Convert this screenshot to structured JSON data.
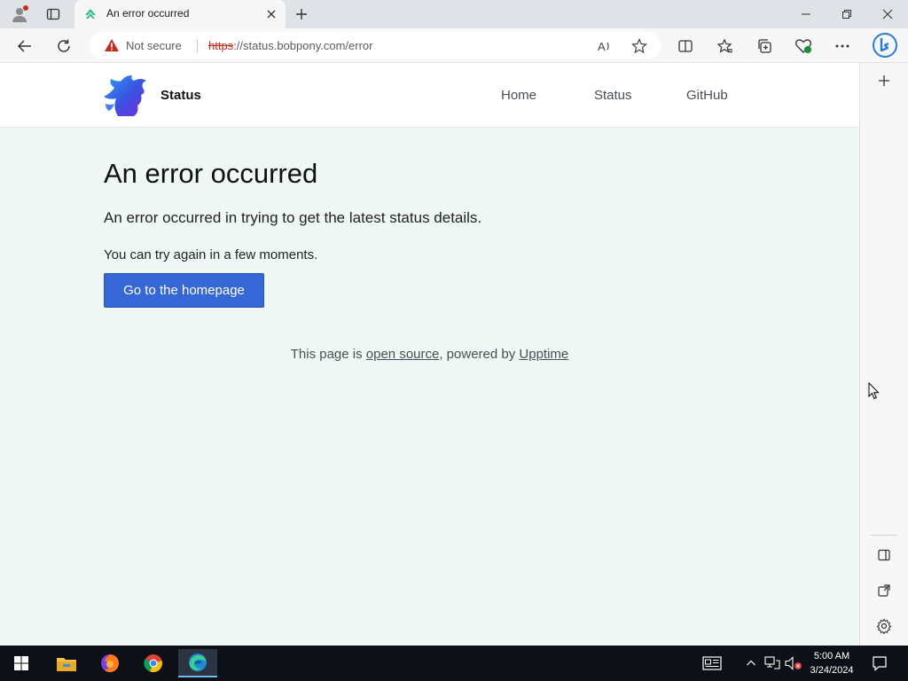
{
  "browser": {
    "tab": {
      "title": "An error occurred"
    },
    "address": {
      "security_label": "Not secure",
      "url_scheme": "https",
      "url_rest": "://status.bobpony.com/error"
    }
  },
  "site": {
    "brand": "Status",
    "nav": [
      {
        "label": "Home"
      },
      {
        "label": "Status"
      },
      {
        "label": "GitHub"
      }
    ],
    "heading": "An error occurred",
    "lead": "An error occurred in trying to get the latest status details.",
    "retry_text": "You can try again in a few moments.",
    "cta_label": "Go to the homepage",
    "footer": {
      "prefix": "This page is ",
      "link1": "open source",
      "middle": ", powered by ",
      "link2": "Upptime"
    }
  },
  "taskbar": {
    "time": "5:00 AM",
    "date": "3/24/2024"
  },
  "colors": {
    "accent_button": "#3567d6",
    "page_background": "#f0f8f6",
    "warning_red": "#c42b1c",
    "taskbar": "#0d1117"
  },
  "icons": [
    "profile-icon",
    "tab-actions-icon",
    "upptime-favicon-icon",
    "close-tab-icon",
    "new-tab-icon",
    "minimize-icon",
    "restore-icon",
    "close-window-icon",
    "back-icon",
    "refresh-icon",
    "warning-icon",
    "read-aloud-icon",
    "favorite-star-icon",
    "split-screen-icon",
    "favorites-icon",
    "collections-icon",
    "browser-essentials-icon",
    "more-icon",
    "bing-copilot-icon",
    "add-sidebar-icon",
    "sidebar-toggle-icon",
    "external-open-icon",
    "settings-icon",
    "windows-start-icon",
    "file-explorer-icon",
    "firefox-icon",
    "chrome-icon",
    "edge-icon",
    "news-icon",
    "tray-chevron-icon",
    "network-icon",
    "volume-muted-icon",
    "notifications-icon",
    "mouse-cursor-icon"
  ]
}
